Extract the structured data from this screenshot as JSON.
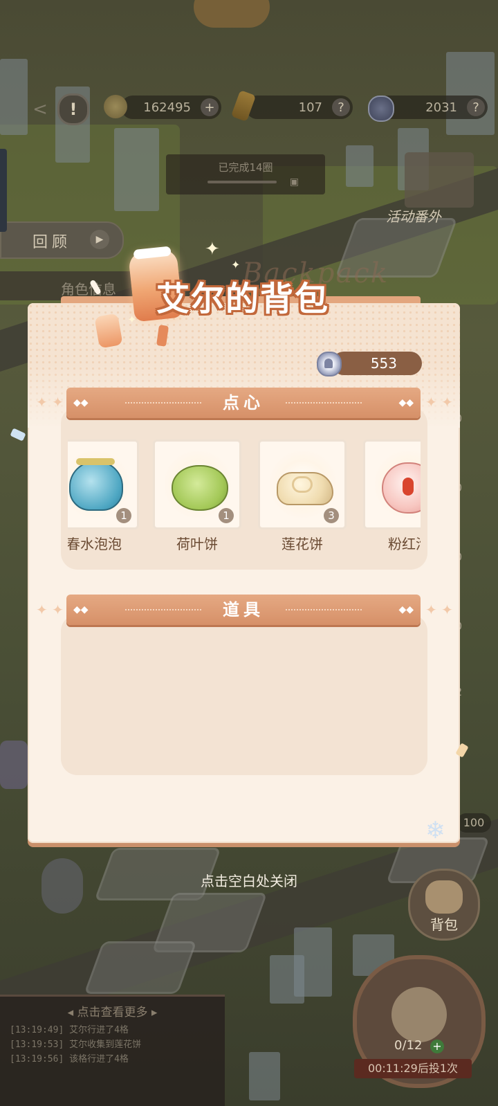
{
  "hud": {
    "coins": "162495",
    "gems": "107",
    "tokens": "2031",
    "round_status": "已完成14圈",
    "review_label": "回顾",
    "event_label": "活动番外",
    "role_info_label": "角色信息",
    "bag_label": "背包",
    "hundred_badge": "100",
    "dice_count": "0/12",
    "timer": "00:11:29后投1次",
    "side_counts": [
      "0",
      "0",
      "0",
      "0",
      "2"
    ]
  },
  "log": {
    "header": "点击查看更多",
    "entries": [
      "[13:19:49] 艾尔行进了4格",
      "[13:19:53] 艾尔收集到莲花饼",
      "[13:19:56] 该格行进了4格"
    ]
  },
  "modal": {
    "title": "艾尔的背包",
    "title_en": "Backpack",
    "currency": "553",
    "snacks_section": "点心",
    "items_section": "道具",
    "snack_items": [
      {
        "name": "春水泡泡",
        "count": "1",
        "icon": "blue-jelly-icon"
      },
      {
        "name": "荷叶饼",
        "count": "1",
        "icon": "lotus-leaf-cake-icon"
      },
      {
        "name": "莲花饼",
        "count": "3",
        "icon": "lotus-flower-cake-icon"
      },
      {
        "name": "粉红泡",
        "count": "",
        "icon": "pink-bun-icon"
      }
    ]
  },
  "close_hint": "点击空白处关闭",
  "colors": {
    "panel": "#fbf1e6",
    "section_bar": "#d99570",
    "title_text": "#c2683b",
    "currency_pill": "#8a5f44"
  }
}
